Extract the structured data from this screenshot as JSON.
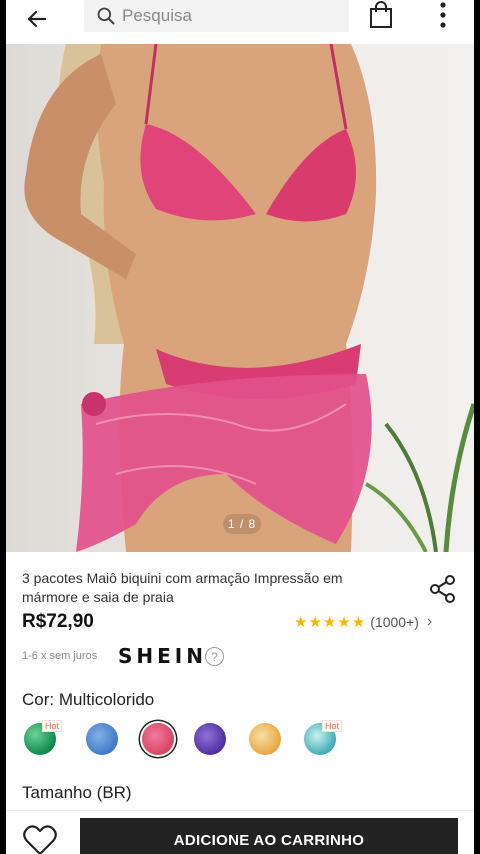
{
  "search": {
    "placeholder": "Pesquisa"
  },
  "gallery": {
    "pager": "1 / 8"
  },
  "product": {
    "title": "3 pacotes Maiô biquini com armação Impressão em mármore e saia de praia",
    "price": "R$72,90",
    "rating": {
      "stars": 4.5,
      "count": "(1000+)"
    },
    "installments": "1-6 x sem juros",
    "brand": "SHEIN"
  },
  "color": {
    "label": "Cor: Multicolorido",
    "options": [
      {
        "name": "green-marble",
        "hot": "Hot"
      },
      {
        "name": "blue",
        "hot": ""
      },
      {
        "name": "pink",
        "hot": "",
        "selected": true
      },
      {
        "name": "purple",
        "hot": ""
      },
      {
        "name": "yellow",
        "hot": ""
      },
      {
        "name": "teal",
        "hot": "Hot"
      }
    ]
  },
  "size": {
    "label": "Tamanho (BR)"
  },
  "actions": {
    "add_to_cart": "ADICIONE AO CARRINHO"
  },
  "colors": {
    "accent": "#222222",
    "hot": "#fa6338",
    "star": "#f5b800",
    "swimsuit": "#e0457a"
  }
}
